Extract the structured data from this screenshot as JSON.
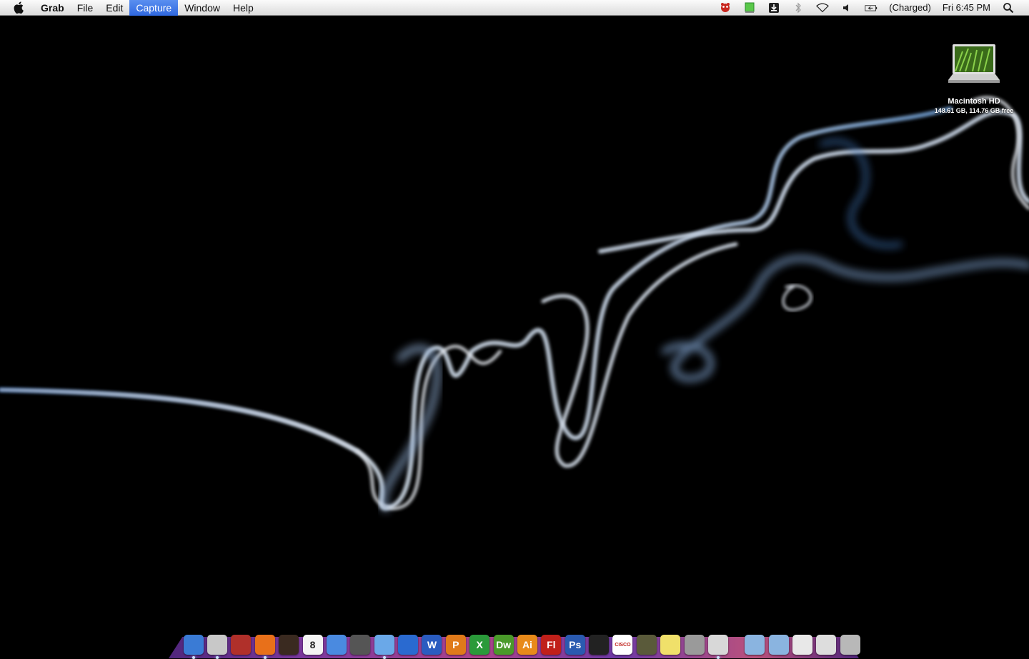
{
  "menubar": {
    "app_name": "Grab",
    "menus": [
      "File",
      "Edit",
      "Capture",
      "Window",
      "Help"
    ],
    "active_menu": "Capture",
    "status": {
      "battery_text": "(Charged)",
      "clock": "Fri 6:45 PM"
    },
    "status_icons": [
      "growl-icon",
      "green-status-icon",
      "dropbox-icon",
      "bluetooth-icon",
      "wifi-icon",
      "volume-icon",
      "battery-icon",
      "spotlight-icon"
    ]
  },
  "desktop": {
    "hd_icon": {
      "name": "Macintosh HD",
      "info": "148.61 GB, 114.76 GB free"
    }
  },
  "dock": {
    "apps": [
      {
        "icon": "finder-icon",
        "label": "",
        "color": "#3a7bd5",
        "running": true
      },
      {
        "icon": "preview-icon",
        "label": "",
        "color": "#c8c8c8",
        "running": true
      },
      {
        "icon": "photo-booth-icon",
        "label": "",
        "color": "#b0302a",
        "running": false
      },
      {
        "icon": "firefox-icon",
        "label": "",
        "color": "#e8701a",
        "running": true
      },
      {
        "icon": "coffee-icon",
        "label": "",
        "color": "#3a2a20",
        "running": false
      },
      {
        "icon": "ical-icon",
        "label": "8",
        "color": "#f4f4f4",
        "running": false
      },
      {
        "icon": "ichat-icon",
        "label": "",
        "color": "#4a8ae0",
        "running": false
      },
      {
        "icon": "dvd-player-icon",
        "label": "",
        "color": "#555555",
        "running": false
      },
      {
        "icon": "itunes-icon",
        "label": "",
        "color": "#6aa8e8",
        "running": true
      },
      {
        "icon": "blue-figure-icon",
        "label": "",
        "color": "#2a6ad0",
        "running": false
      },
      {
        "icon": "word-icon",
        "label": "W",
        "color": "#2a5cc0",
        "running": false
      },
      {
        "icon": "powerpoint-icon",
        "label": "P",
        "color": "#e07a1a",
        "running": false
      },
      {
        "icon": "excel-icon",
        "label": "X",
        "color": "#2a9a3a",
        "running": false
      },
      {
        "icon": "dreamweaver-icon",
        "label": "Dw",
        "color": "#4a9a2a",
        "running": false
      },
      {
        "icon": "illustrator-icon",
        "label": "Ai",
        "color": "#e88a1a",
        "running": false
      },
      {
        "icon": "flash-icon",
        "label": "Fl",
        "color": "#c0201a",
        "running": false
      },
      {
        "icon": "photoshop-icon",
        "label": "Ps",
        "color": "#2a5ab0",
        "running": false
      },
      {
        "icon": "camera-lens-icon",
        "label": "",
        "color": "#222222",
        "running": false
      },
      {
        "icon": "cisco-icon",
        "label": "CISCO",
        "color": "#ffffff",
        "running": false
      },
      {
        "icon": "wizard-icon",
        "label": "",
        "color": "#5a5a3a",
        "running": false
      },
      {
        "icon": "stickies-icon",
        "label": "",
        "color": "#f0e06a",
        "running": false
      },
      {
        "icon": "utility-icon",
        "label": "",
        "color": "#9a9a9a",
        "running": false
      },
      {
        "icon": "easel-icon",
        "label": "",
        "color": "#d8d8d8",
        "running": true
      }
    ],
    "stacks": [
      {
        "icon": "applications-folder-icon",
        "color": "#8ab4e0"
      },
      {
        "icon": "documents-folder-icon",
        "color": "#8ab4e0"
      },
      {
        "icon": "downloads-stack-icon",
        "color": "#e8e8e8"
      },
      {
        "icon": "screen-icon",
        "color": "#dddddd"
      },
      {
        "icon": "trash-icon",
        "color": "#b8b8b8"
      }
    ]
  }
}
